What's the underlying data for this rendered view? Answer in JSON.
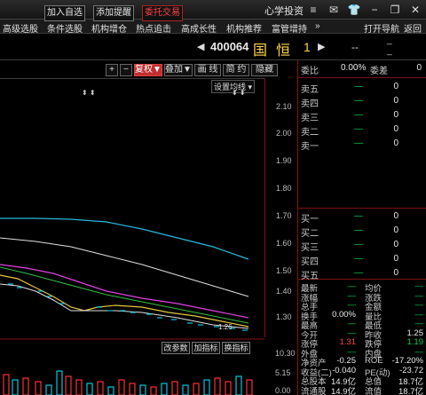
{
  "window": {
    "title": "心学投资",
    "icons": [
      "menu-icon",
      "envelope-icon",
      "shirt-icon",
      "minimize-icon",
      "restore-icon",
      "close-icon"
    ]
  },
  "menu": {
    "items": [
      "高级选股",
      "条件选股",
      "机构增仓",
      "热点追击",
      "高成长性",
      "机构推荐",
      "富管增持",
      "»"
    ],
    "right": [
      "打开导航",
      "返回"
    ]
  },
  "toolbar": {
    "add_watch": "加入自选",
    "add_alert": "添加提醒",
    "trade": "委托交易",
    "code": "400064",
    "name": "国恒",
    "name_suffix": "1",
    "price_placeholder": "--",
    "mini1": "_",
    "mini2": "_"
  },
  "chart_toolbar": {
    "plus": "+",
    "minus": "−",
    "fuquan": "复权▼",
    "overlay": "叠加▼",
    "draw": "画 线",
    "simple": "简 约",
    "hide": "隐藏"
  },
  "chart": {
    "settings_label": "设置均线 ▾",
    "price_ticks": [
      "2.10",
      "2.00",
      "1.90",
      "1.80",
      "1.70",
      "1.60",
      "1.50",
      "1.40",
      "1.30"
    ],
    "low_label": "1.26",
    "sub_buttons": [
      "改参数",
      "加指标",
      "换指标"
    ],
    "vol_ticks": [
      "10.30",
      "5.15",
      "0.00"
    ],
    "colors": {
      "white": "#e0e0e0",
      "cyan": "#28b8d8",
      "yellow": "#e6c640",
      "magenta": "#e040e0",
      "green": "#30c040",
      "up": "#ff3030",
      "down": "#00c8e0"
    }
  },
  "quote": {
    "header": {
      "label_wb": "委比",
      "wb": "0.00%",
      "label_wc": "委差",
      "wc": "0"
    },
    "sells": [
      {
        "label": "卖五",
        "price": "—",
        "vol": "0"
      },
      {
        "label": "卖四",
        "price": "—",
        "vol": "0"
      },
      {
        "label": "卖三",
        "price": "—",
        "vol": "0"
      },
      {
        "label": "卖二",
        "price": "—",
        "vol": "0"
      },
      {
        "label": "卖一",
        "price": "—",
        "vol": "0"
      }
    ],
    "buys": [
      {
        "label": "买一",
        "price": "—",
        "vol": "0"
      },
      {
        "label": "买二",
        "price": "—",
        "vol": "0"
      },
      {
        "label": "买三",
        "price": "—",
        "vol": "0"
      },
      {
        "label": "买四",
        "price": "—",
        "vol": "0"
      },
      {
        "label": "买五",
        "price": "—",
        "vol": "0"
      }
    ],
    "stats": [
      [
        "最新",
        "—",
        "均价",
        "—"
      ],
      [
        "涨幅",
        "—",
        "涨跌",
        "—"
      ],
      [
        "总手",
        "—",
        "金额",
        "—"
      ],
      [
        "换手",
        "0.00%",
        "量比",
        "—"
      ],
      [
        "最高",
        "—",
        "最低",
        "—"
      ],
      [
        "今开",
        "—",
        "昨收",
        "1.25"
      ],
      [
        "涨停",
        "1.31",
        "跌停",
        "1.19"
      ],
      [
        "外盘",
        "—",
        "内盘",
        "—"
      ],
      [
        "净资产",
        "-0.25",
        "ROE",
        "-17.20%"
      ],
      [
        "收益(二)",
        "-0.040",
        "PE(动)",
        "-23.72"
      ],
      [
        "总股本",
        "14.9亿",
        "总值",
        "18.7亿"
      ],
      [
        "流通股",
        "14.9亿",
        "流值",
        "18.7亿"
      ]
    ]
  }
}
